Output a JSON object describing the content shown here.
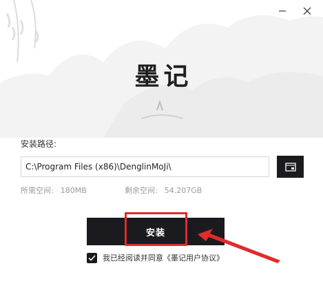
{
  "window": {
    "minimize_icon": "minimize-icon",
    "close_icon": "close-icon"
  },
  "app": {
    "title": "墨记"
  },
  "install_path": {
    "label": "安装路径:",
    "value": "C:\\Program Files (x86)\\DenglinMoJi\\",
    "browse_icon": "folder-icon"
  },
  "disk_space": {
    "required_label": "所需空间:",
    "required_value": "180MB",
    "remaining_label": "剩余空间:",
    "remaining_value": "54.207GB"
  },
  "install_button": {
    "label": "安装"
  },
  "agreement": {
    "checked": true,
    "text": "我已经阅读并同意",
    "link": "《墨记用户协议》"
  },
  "colors": {
    "primary_dark": "#1b1b1f",
    "annotation_red": "#e02b2b",
    "background": "#ffffff"
  }
}
